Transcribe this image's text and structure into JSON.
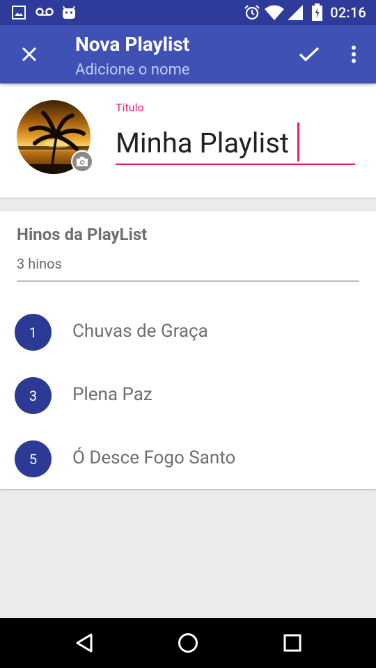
{
  "status_bar": {
    "time": "02:16",
    "left_icons": [
      "image-icon",
      "voicemail-icon",
      "android-icon"
    ],
    "right_icons": [
      "alarm-icon",
      "wifi-icon",
      "signal-icon",
      "battery-icon"
    ],
    "color": "#2f3b9a"
  },
  "app_bar": {
    "title": "Nova Playlist",
    "subtitle": "Adicione o nome",
    "close_icon": "close-icon",
    "confirm_icon": "check-icon",
    "menu_icon": "more-vert-icon",
    "color": "#3f51b5"
  },
  "playlist_header": {
    "cover_icon": "camera-icon",
    "title_label": "Título",
    "title_value": "Minha Playlist",
    "accent_color": "#e91e63"
  },
  "hymns_section": {
    "title": "Hinos da PlayList",
    "count": "3 hinos",
    "items": [
      {
        "number": "1",
        "title": "Chuvas de Graça"
      },
      {
        "number": "3",
        "title": "Plena Paz"
      },
      {
        "number": "5",
        "title": "Ó Desce Fogo Santo"
      }
    ],
    "badge_color": "#2d3a95"
  },
  "nav_bar": {
    "back_icon": "back-icon",
    "home_icon": "home-icon",
    "recents_icon": "recents-icon"
  }
}
